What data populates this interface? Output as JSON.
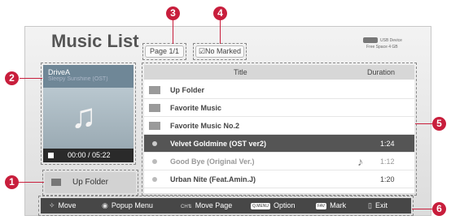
{
  "title": "Music List",
  "page_indicator": "Page 1/1",
  "marked_indicator": "☑No Marked",
  "usb": {
    "device": "USB Device",
    "free_space": "Free Space 4 GB"
  },
  "preview": {
    "drive": "DriveA",
    "subtitle": "Sleepy Sunshine (OST)",
    "time": "00:00 / 05:22",
    "note_glyph": "♫"
  },
  "up_folder_button": "Up Folder",
  "list": {
    "columns": {
      "title": "Title",
      "duration": "Duration"
    },
    "rows": [
      {
        "name": "Up Folder",
        "duration": ""
      },
      {
        "name": "Favorite Music",
        "duration": ""
      },
      {
        "name": "Favorite Music No.2",
        "duration": ""
      },
      {
        "name": "Velvet Goldmine (OST ver2)",
        "duration": "1:24"
      },
      {
        "name": "Good Bye (Original Ver.)",
        "duration": "1:12"
      },
      {
        "name": "Urban Nite (Feat.Amin.J)",
        "duration": "1:20"
      }
    ],
    "selected_row": 3,
    "playing_glyph": "♪"
  },
  "footer": {
    "move": "Move",
    "popup_menu": "Popup Menu",
    "move_page": "Move Page",
    "option_key": "Q.MENU",
    "option": "Option",
    "mark_key": "FAV",
    "mark": "Mark",
    "exit": "Exit",
    "move_glyph": "✧",
    "ok_glyph": "◉",
    "ch_glyph": "CH⇅",
    "exit_glyph": "▯"
  },
  "callouts": [
    "1",
    "2",
    "3",
    "4",
    "5",
    "6"
  ],
  "colors": {
    "callout": "#c81e3c",
    "selected_row": "#555555",
    "footer": "#474747"
  }
}
